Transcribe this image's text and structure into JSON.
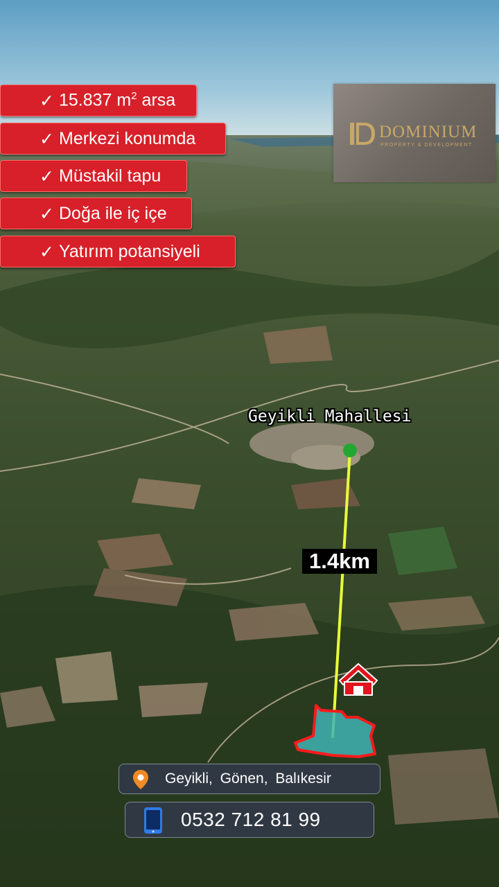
{
  "features": [
    {
      "check": "✓",
      "text": "15.837 m",
      "sup": "2",
      "suffix": " arsa"
    },
    {
      "check": "✓",
      "text": "Merkezi konumda"
    },
    {
      "check": "✓",
      "text": "Müstakil tapu"
    },
    {
      "check": "✓",
      "text": "Doğa ile iç içe"
    },
    {
      "check": "✓",
      "text": "Yatırım potansiyeli"
    }
  ],
  "logo": {
    "name": "DOMINIUM",
    "subtitle": "PROPERTY & DEVELOPMENT",
    "color": "#c8a867"
  },
  "map": {
    "place_label": "Geyikli Mahallesi",
    "distance_label": "1.4km",
    "line_color": "#e8ff3a",
    "start_marker_color": "#22a832",
    "home_icon": "home-icon",
    "parcel_fill": "#3fb3b3",
    "parcel_outline": "#ff1a1a"
  },
  "location": {
    "icon": "location-pin-icon",
    "text": "Geyikli, Gönen, Balıkesir",
    "icon_color": "#f08a24"
  },
  "phone": {
    "icon": "smartphone-icon",
    "text": "0532 712 81 99",
    "icon_color": "#2f7be6"
  }
}
